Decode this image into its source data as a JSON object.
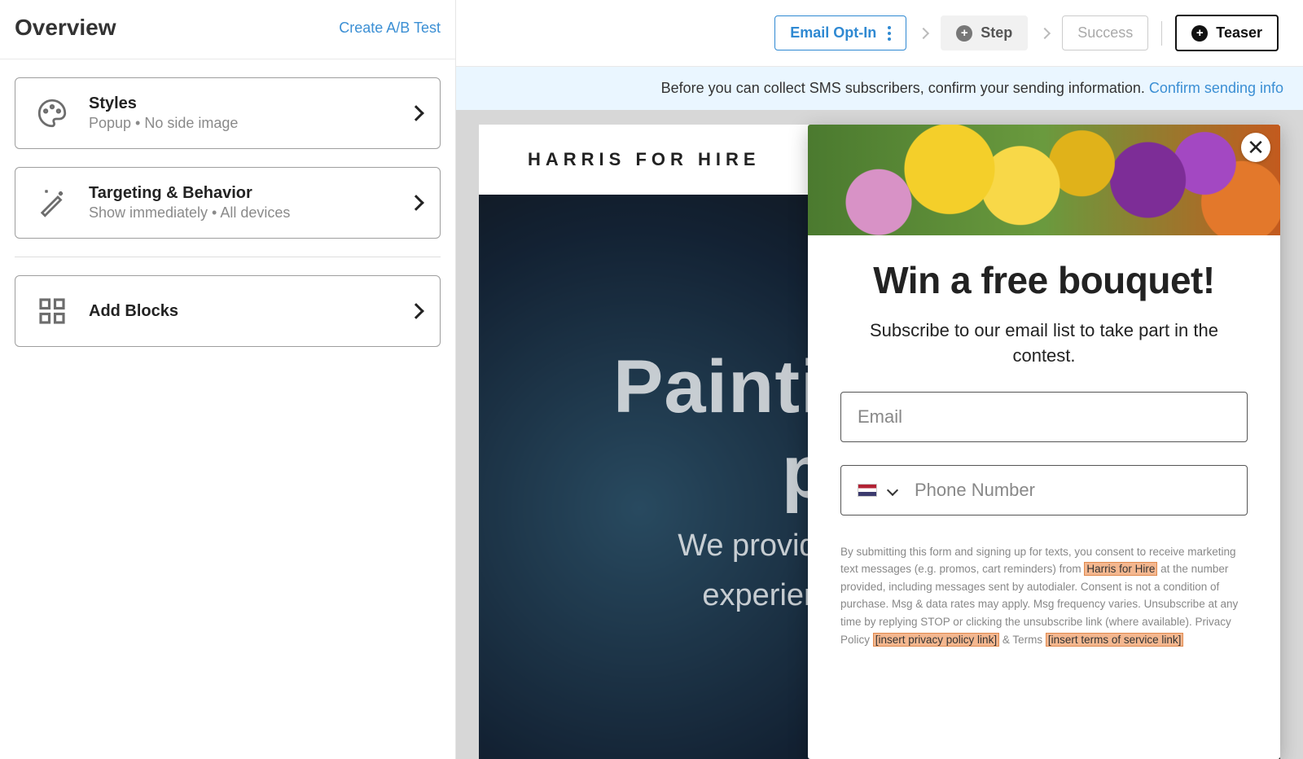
{
  "sidebar": {
    "title": "Overview",
    "ab_link": "Create A/B Test",
    "cards": {
      "styles": {
        "title": "Styles",
        "sub": "Popup • No side image"
      },
      "targeting": {
        "title": "Targeting & Behavior",
        "sub": "Show immediately • All devices"
      },
      "blocks": {
        "title": "Add Blocks"
      }
    }
  },
  "tabs": {
    "email": "Email Opt-In",
    "step": "Step",
    "success": "Success",
    "teaser": "Teaser"
  },
  "banner": {
    "text": "Before you can collect SMS subscribers, confirm your sending information. ",
    "link": "Confirm sending info"
  },
  "site": {
    "brand": "HARRIS FOR HIRE",
    "hero_title": "Painting is our passi",
    "hero_sub_1": "We provide a premium gamin",
    "hero_sub_2": "experience tailored to you"
  },
  "popup": {
    "title": "Win a free bouquet!",
    "sub": "Subscribe to our email list to take part in the contest.",
    "email_placeholder": "Email",
    "phone_placeholder": "Phone Number",
    "legal_pre": "By submitting this form and signing up for texts, you consent to receive marketing text messages (e.g. promos, cart reminders) from ",
    "legal_company": "Harris for Hire",
    "legal_mid": " at the number provided, including messages sent by autodialer. Consent is not a condition of purchase. Msg & data rates may apply. Msg frequency varies. Unsubscribe at any time by replying STOP or clicking the unsubscribe link (where available). Privacy Policy ",
    "legal_privacy": "[insert privacy policy link]",
    "legal_and": " & Terms ",
    "legal_terms": "[insert terms of service link]"
  }
}
